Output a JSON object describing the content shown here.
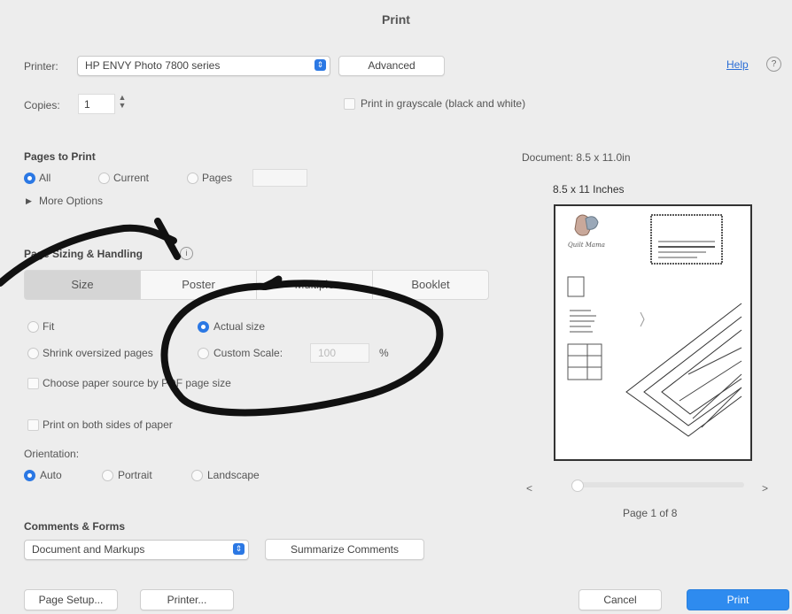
{
  "dialog": {
    "title": "Print"
  },
  "printer": {
    "label": "Printer:",
    "value": "HP ENVY Photo 7800 series",
    "advanced": "Advanced",
    "help": "Help",
    "help_icon": "?"
  },
  "copies": {
    "label": "Copies:",
    "value": "1",
    "grayscale": "Print in grayscale (black and white)"
  },
  "pages": {
    "heading": "Pages to Print",
    "all": "All",
    "current": "Current",
    "pages": "Pages",
    "more": "More Options",
    "more_icon": "▶"
  },
  "sizing": {
    "heading": "Page Sizing & Handling",
    "info_icon": "i",
    "tabs": [
      "Size",
      "Poster",
      "Multiple",
      "Booklet"
    ],
    "fit": "Fit",
    "actual": "Actual size",
    "shrink": "Shrink oversized pages",
    "custom": "Custom Scale:",
    "custom_value": "100",
    "percent": "%",
    "choose": "Choose paper source by PDF page size",
    "duplex": "Print on both sides of paper"
  },
  "orientation": {
    "label": "Orientation:",
    "auto": "Auto",
    "portrait": "Portrait",
    "landscape": "Landscape"
  },
  "comments": {
    "heading": "Comments & Forms",
    "value": "Document and Markups",
    "summarize": "Summarize Comments"
  },
  "preview": {
    "doc": "Document: 8.5 x 11.0in",
    "size": "8.5 x 11 Inches",
    "page": "Page 1 of 8",
    "prev": "<",
    "next": ">",
    "logo_text": "Quilt Mama"
  },
  "footer": {
    "page_setup": "Page Setup...",
    "printer": "Printer...",
    "cancel": "Cancel",
    "print": "Print"
  },
  "colors": {
    "accent": "#2b78e4",
    "print_button": "#2e8bef",
    "annotation": "#111111"
  }
}
